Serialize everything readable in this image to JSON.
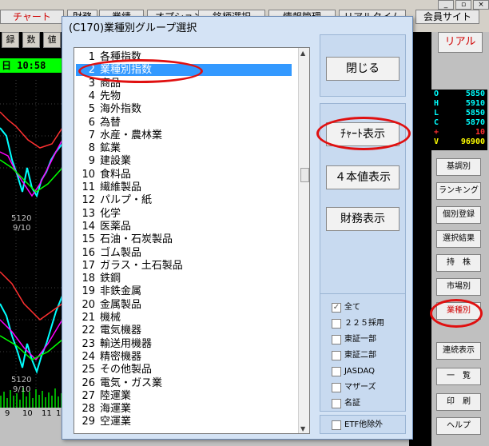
{
  "topbar": {
    "tabs": [
      "チャート",
      "財務",
      "業績",
      "オプション",
      "銘柄選択",
      "情報管理",
      "リアルタイム",
      "会員サイト"
    ]
  },
  "leftpanel": {
    "buttons": [
      "録",
      "数",
      "値"
    ],
    "time": "日 10:58",
    "price_labels": [
      "5120",
      "9/10",
      "5120",
      "9/10"
    ],
    "axis_labels": [
      "9",
      "10",
      "11",
      "1"
    ]
  },
  "quote": {
    "rows": [
      {
        "label": "O",
        "value": "5850",
        "color": "#00ffff"
      },
      {
        "label": "H",
        "value": "5910",
        "color": "#00ffff"
      },
      {
        "label": "L",
        "value": "5850",
        "color": "#00ffff"
      },
      {
        "label": "C",
        "value": "5870",
        "color": "#00ffff"
      },
      {
        "label": "+",
        "value": "10",
        "color": "#ff3030"
      },
      {
        "label": "V",
        "value": "96900",
        "color": "#ffff00"
      }
    ]
  },
  "rightpanel": {
    "real_label": "リアル",
    "buttons": [
      "基調別",
      "ランキング",
      "個別登録",
      "選択結果",
      "持　株",
      "市場別",
      "業種別",
      "連続表示",
      "一　覧",
      "印　刷",
      "ヘルプ"
    ]
  },
  "dialog": {
    "title": "(C170)業種別グループ選択",
    "items": [
      {
        "num": "1",
        "label": "各種指数"
      },
      {
        "num": "2",
        "label": "業種別指数"
      },
      {
        "num": "3",
        "label": "商品"
      },
      {
        "num": "4",
        "label": "先物"
      },
      {
        "num": "5",
        "label": "海外指数"
      },
      {
        "num": "6",
        "label": "為替"
      },
      {
        "num": "7",
        "label": "水産・農林業"
      },
      {
        "num": "8",
        "label": "鉱業"
      },
      {
        "num": "9",
        "label": "建設業"
      },
      {
        "num": "10",
        "label": "食料品"
      },
      {
        "num": "11",
        "label": "繊維製品"
      },
      {
        "num": "12",
        "label": "パルプ・紙"
      },
      {
        "num": "13",
        "label": "化学"
      },
      {
        "num": "14",
        "label": "医薬品"
      },
      {
        "num": "15",
        "label": "石油・石炭製品"
      },
      {
        "num": "16",
        "label": "ゴム製品"
      },
      {
        "num": "17",
        "label": "ガラス・土石製品"
      },
      {
        "num": "18",
        "label": "鉄鋼"
      },
      {
        "num": "19",
        "label": "非鉄金属"
      },
      {
        "num": "20",
        "label": "金属製品"
      },
      {
        "num": "21",
        "label": "機械"
      },
      {
        "num": "22",
        "label": "電気機器"
      },
      {
        "num": "23",
        "label": "輸送用機器"
      },
      {
        "num": "24",
        "label": "精密機器"
      },
      {
        "num": "25",
        "label": "その他製品"
      },
      {
        "num": "26",
        "label": "電気・ガス業"
      },
      {
        "num": "27",
        "label": "陸運業"
      },
      {
        "num": "28",
        "label": "海運業"
      },
      {
        "num": "29",
        "label": "空運業"
      }
    ],
    "selected_index": 1,
    "buttons": {
      "close": "閉じる",
      "chart": "ﾁｬｰﾄ表示",
      "four_values": "４本値表示",
      "financial": "財務表示"
    },
    "checks": [
      {
        "label": "全て",
        "checked": true
      },
      {
        "label": "２２５採用",
        "checked": false
      },
      {
        "label": "東証一部",
        "checked": false
      },
      {
        "label": "東証二部",
        "checked": false
      },
      {
        "label": "JASDAQ",
        "checked": false
      },
      {
        "label": "マザーズ",
        "checked": false
      },
      {
        "label": "名証",
        "checked": false
      }
    ],
    "etf": {
      "label": "ETF他除外",
      "checked": false
    }
  },
  "colors": {
    "highlight": "#e01010",
    "selection": "#3399ff"
  }
}
